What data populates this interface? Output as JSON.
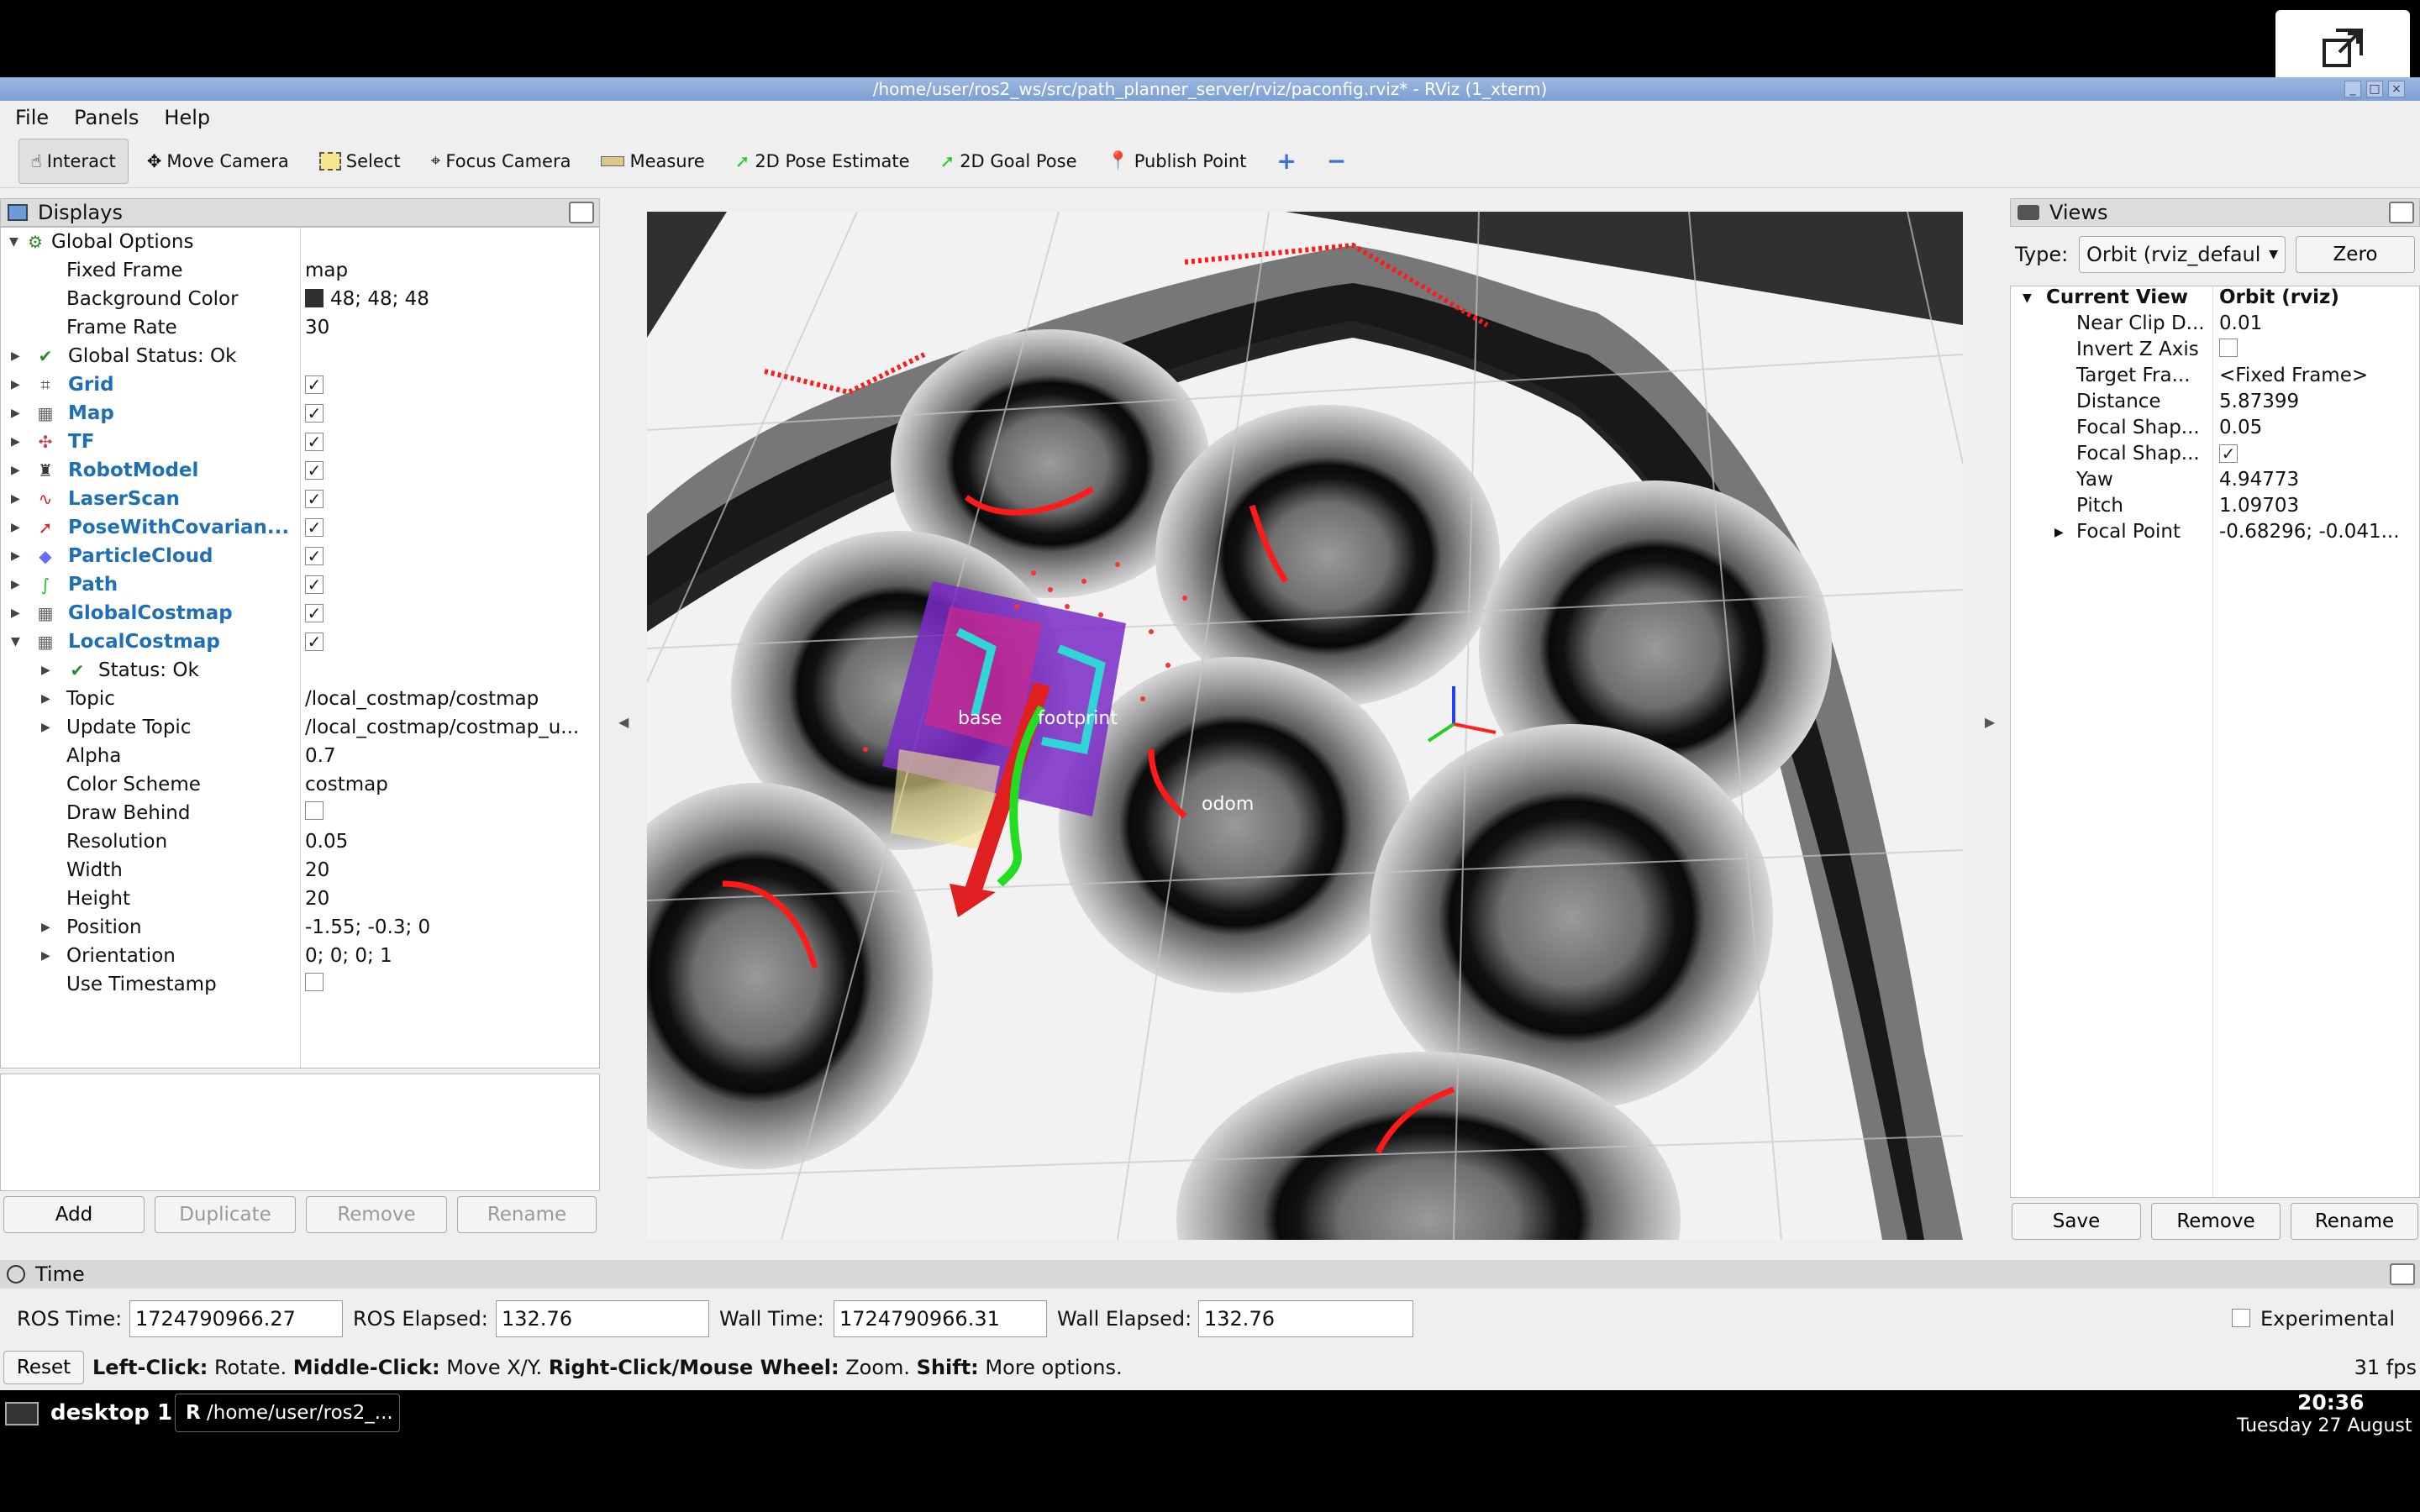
{
  "window": {
    "title": "/home/user/ros2_ws/src/path_planner_server/rviz/paconfig.rviz* - RViz (1_xterm)"
  },
  "menu": [
    "File",
    "Panels",
    "Help"
  ],
  "toolbar": {
    "interact": "Interact",
    "move_camera": "Move Camera",
    "select": "Select",
    "focus_camera": "Focus Camera",
    "measure": "Measure",
    "pose_estimate": "2D Pose Estimate",
    "goal_pose": "2D Goal Pose",
    "publish_point": "Publish Point"
  },
  "displays": {
    "title": "Displays",
    "global_options": "Global Options",
    "fixed_frame_label": "Fixed Frame",
    "fixed_frame": "map",
    "bg_color_label": "Background Color",
    "bg_color": "48; 48; 48",
    "frame_rate_label": "Frame Rate",
    "frame_rate": "30",
    "global_status": "Global Status: Ok",
    "items": [
      {
        "label": "Grid"
      },
      {
        "label": "Map"
      },
      {
        "label": "TF"
      },
      {
        "label": "RobotModel"
      },
      {
        "label": "LaserScan"
      },
      {
        "label": "PoseWithCovarian..."
      },
      {
        "label": "ParticleCloud"
      },
      {
        "label": "Path"
      },
      {
        "label": "GlobalCostmap"
      },
      {
        "label": "LocalCostmap"
      }
    ],
    "local": {
      "status": "Status: Ok",
      "topic_label": "Topic",
      "topic": "/local_costmap/costmap",
      "update_topic_label": "Update Topic",
      "update_topic": "/local_costmap/costmap_u...",
      "alpha_label": "Alpha",
      "alpha": "0.7",
      "color_scheme_label": "Color Scheme",
      "color_scheme": "costmap",
      "draw_behind_label": "Draw Behind",
      "resolution_label": "Resolution",
      "resolution": "0.05",
      "width_label": "Width",
      "width": "20",
      "height_label": "Height",
      "height": "20",
      "position_label": "Position",
      "position": "-1.55; -0.3; 0",
      "orientation_label": "Orientation",
      "orientation": "0; 0; 0; 1",
      "use_timestamp_label": "Use Timestamp"
    },
    "buttons": {
      "add": "Add",
      "duplicate": "Duplicate",
      "remove": "Remove",
      "rename": "Rename"
    }
  },
  "viewport": {
    "labels": {
      "base": "base",
      "footprint": "footprint",
      "odom": "odom"
    },
    "colors": {
      "background": "#303030",
      "laser": "#ff1a1a",
      "path": "#22dd22",
      "pose_arrow": "#e02020"
    }
  },
  "views": {
    "title": "Views",
    "type_label": "Type:",
    "type_value": "Orbit (rviz_defaul",
    "zero": "Zero",
    "current_view": "Current View",
    "current_view_value": "Orbit (rviz)",
    "rows": [
      {
        "label": "Near Clip D...",
        "value": "0.01"
      },
      {
        "label": "Invert Z Axis",
        "value": ""
      },
      {
        "label": "Target Fra...",
        "value": "<Fixed Frame>"
      },
      {
        "label": "Distance",
        "value": "5.87399"
      },
      {
        "label": "Focal Shap...",
        "value": "0.05"
      },
      {
        "label": "Focal Shap...",
        "value": ""
      },
      {
        "label": "Yaw",
        "value": "4.94773"
      },
      {
        "label": "Pitch",
        "value": "1.09703"
      },
      {
        "label": "Focal Point",
        "value": "-0.68296; -0.041..."
      }
    ],
    "buttons": {
      "save": "Save",
      "remove": "Remove",
      "rename": "Rename"
    }
  },
  "time": {
    "title": "Time",
    "ros_time_label": "ROS Time:",
    "ros_time": "1724790966.27",
    "ros_elapsed_label": "ROS Elapsed:",
    "ros_elapsed": "132.76",
    "wall_time_label": "Wall Time:",
    "wall_time": "1724790966.31",
    "wall_elapsed_label": "Wall Elapsed:",
    "wall_elapsed": "132.76",
    "experimental": "Experimental"
  },
  "status": {
    "reset": "Reset",
    "left_click": "Left-Click:",
    "left_click_desc": "Rotate.",
    "middle_click": "Middle-Click:",
    "middle_click_desc": "Move X/Y.",
    "right_click": "Right-Click/Mouse Wheel:",
    "right_click_desc": "Zoom.",
    "shift": "Shift:",
    "shift_desc": "More options.",
    "fps": "31 fps"
  },
  "taskbar": {
    "desktop": "desktop 1",
    "task": "/home/user/ros2_...",
    "time": "20:36",
    "date": "Tuesday 27 August"
  }
}
